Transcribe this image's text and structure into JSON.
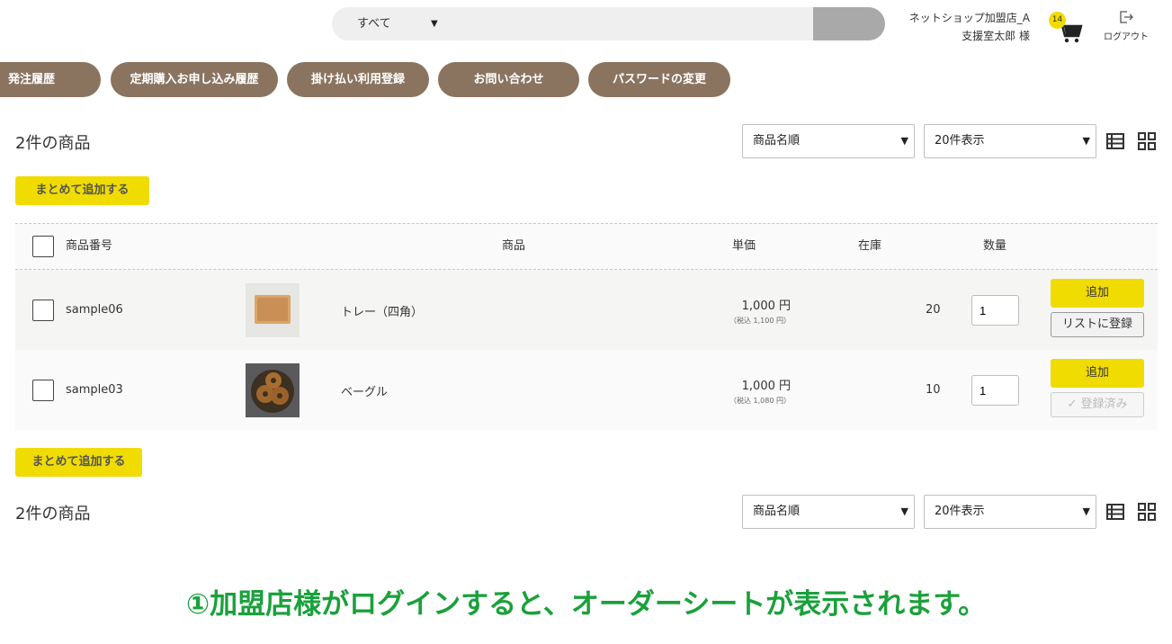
{
  "header": {
    "search_category": "すべて",
    "search_placeholder": "",
    "shop_name": "ネットショップ加盟店_A",
    "user_name": "支援室太郎 様",
    "cart_count": "14",
    "logout_label": "ログアウト"
  },
  "nav": [
    "発注履歴",
    "定期購入お申し込み履歴",
    "掛け払い利用登録",
    "お問い合わせ",
    "パスワードの変更"
  ],
  "toolbar": {
    "count_label": "2件の商品",
    "sort_value": "商品名順",
    "per_page_value": "20件表示",
    "bulk_add_label": "まとめて追加する"
  },
  "table": {
    "headers": {
      "code": "商品番号",
      "product": "商品",
      "price": "単価",
      "stock": "在庫",
      "qty": "数量"
    },
    "rows": [
      {
        "code": "sample06",
        "name": "トレー（四角）",
        "price": "1,000 円",
        "price_tax": "（税込 1,100 円）",
        "stock": "20",
        "qty": "1",
        "add_label": "追加",
        "list_label": "リストに登録"
      },
      {
        "code": "sample03",
        "name": "ベーグル",
        "price": "1,000 円",
        "price_tax": "（税込 1,080 円）",
        "stock": "10",
        "qty": "1",
        "add_label": "追加",
        "list_label": "✓ 登録済み"
      }
    ]
  },
  "caption": "①加盟店様がログインすると、オーダーシートが表示されます。",
  "colors": {
    "accent_yellow": "#f0dc00",
    "nav_brown": "#8a7460",
    "caption_green": "#1aa13b"
  }
}
